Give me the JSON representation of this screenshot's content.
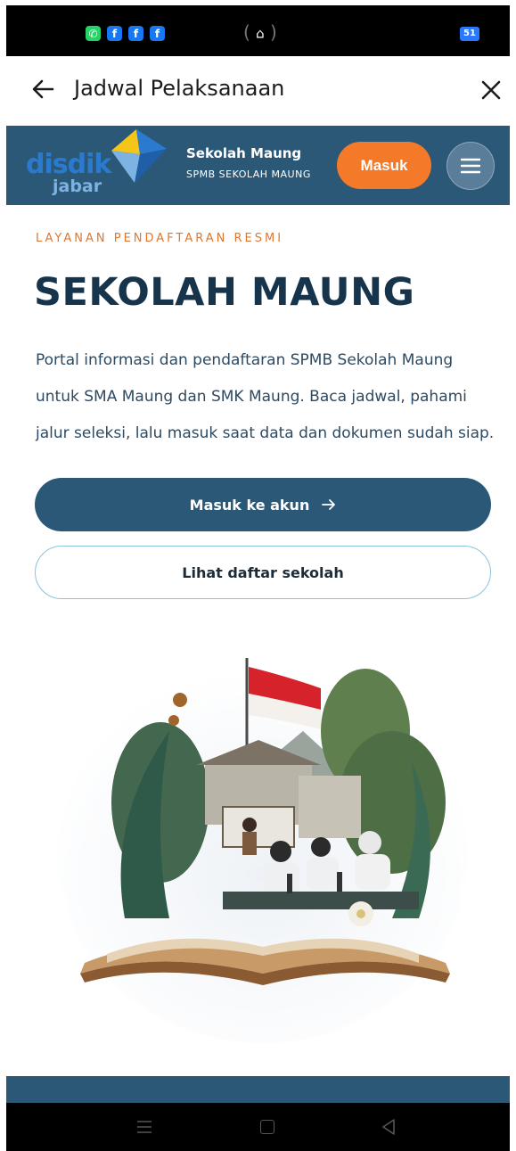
{
  "status_bar": {
    "apps": [
      "whatsapp-icon",
      "facebook-icon",
      "facebook-icon",
      "facebook-icon"
    ],
    "battery": "51"
  },
  "title_bar": {
    "title": "Jadwal Pelaksanaan"
  },
  "site_header": {
    "logo_line1": "disdik",
    "logo_line2": "jabar",
    "brand_title": "Sekolah Maung",
    "brand_subtitle": "SPMB SEKOLAH MAUNG",
    "login_label": "Masuk"
  },
  "hero": {
    "eyebrow": "LAYANAN PENDAFTARAN RESMI",
    "title": "SEKOLAH MAUNG",
    "description": "Portal informasi dan pendaftaran SPMB Sekolah Maung untuk SMA Maung dan SMK Maung. Baca jadwal, pahami jalur seleksi, lalu masuk saat data dan dokumen sudah siap.",
    "primary_button": "Masuk ke akun",
    "secondary_button": "Lihat daftar sekolah"
  },
  "colors": {
    "primary": "#2c5878",
    "accent": "#f47a2a",
    "heading": "#17344d"
  }
}
